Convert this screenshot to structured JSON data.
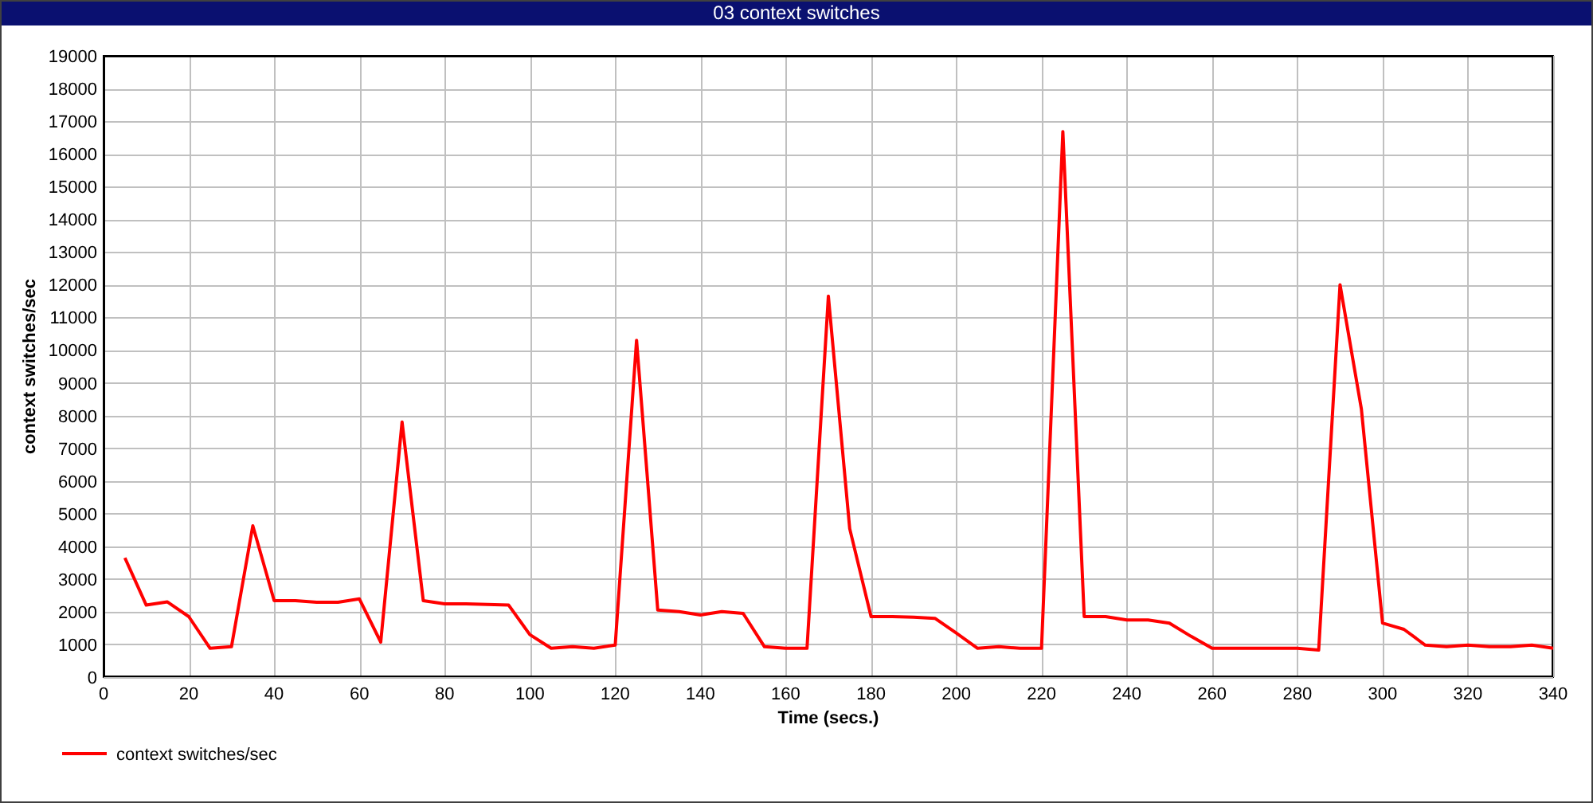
{
  "window": {
    "title": "03 context switches"
  },
  "chart_data": {
    "type": "line",
    "xlabel": "Time (secs.)",
    "ylabel": "context switches/sec",
    "x": [
      5,
      10,
      15,
      20,
      25,
      30,
      35,
      40,
      45,
      50,
      55,
      60,
      65,
      70,
      75,
      80,
      85,
      90,
      95,
      100,
      105,
      110,
      115,
      120,
      125,
      130,
      135,
      140,
      145,
      150,
      155,
      160,
      165,
      170,
      175,
      180,
      185,
      190,
      195,
      200,
      205,
      210,
      215,
      220,
      225,
      230,
      235,
      240,
      245,
      250,
      255,
      260,
      265,
      270,
      275,
      280,
      285,
      290,
      295,
      300,
      305,
      310,
      315,
      320,
      325,
      330,
      335,
      340
    ],
    "series": [
      {
        "name": "context switches/sec",
        "color": "#ff0000",
        "values": [
          3650,
          2200,
          2300,
          1850,
          880,
          930,
          4630,
          2340,
          2340,
          2290,
          2290,
          2390,
          1070,
          7800,
          2340,
          2240,
          2240,
          2220,
          2200,
          1300,
          880,
          930,
          880,
          980,
          10300,
          2050,
          2000,
          1900,
          2000,
          1950,
          930,
          880,
          880,
          11650,
          4540,
          1850,
          1850,
          1830,
          1800,
          1350,
          880,
          930,
          880,
          880,
          16680,
          1850,
          1850,
          1750,
          1750,
          1650,
          1250,
          880,
          880,
          880,
          880,
          880,
          830,
          12000,
          8200,
          1650,
          1460,
          980,
          930,
          980,
          930,
          930,
          980,
          880
        ]
      }
    ],
    "grid": true,
    "xlim": [
      0,
      340
    ],
    "ylim": [
      0,
      19000
    ],
    "xticks": [
      0,
      20,
      40,
      60,
      80,
      100,
      120,
      140,
      160,
      180,
      200,
      220,
      240,
      260,
      280,
      300,
      320,
      340
    ],
    "yticks": [
      0,
      1000,
      2000,
      3000,
      4000,
      5000,
      6000,
      7000,
      8000,
      9000,
      10000,
      11000,
      12000,
      13000,
      14000,
      15000,
      16000,
      17000,
      18000,
      19000
    ]
  }
}
